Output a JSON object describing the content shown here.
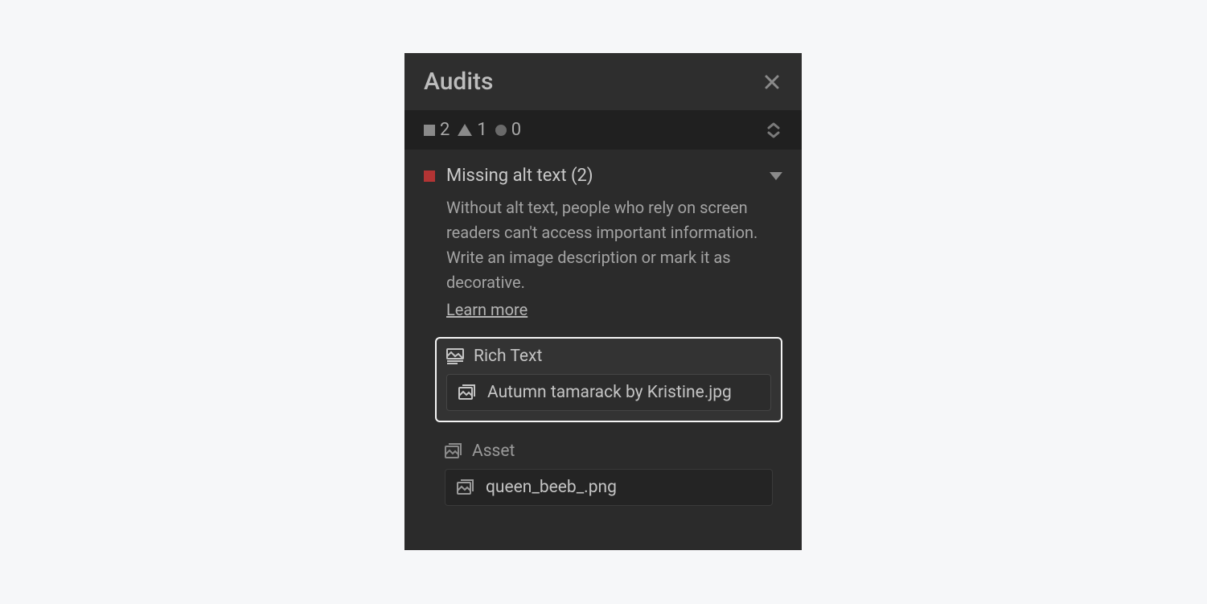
{
  "panel": {
    "title": "Audits"
  },
  "summary": {
    "errors": "2",
    "warnings": "1",
    "info": "0"
  },
  "audit": {
    "title": "Missing alt text (2)",
    "description": "Without alt text, people who rely on screen readers can't access important information. Write an image description or mark it as decorative.",
    "learn_more": "Learn more"
  },
  "groups": [
    {
      "label": "Rich Text",
      "highlighted": true,
      "item": "Autumn tamarack by Kristine.jpg"
    },
    {
      "label": "Asset",
      "highlighted": false,
      "item": "queen_beeb_.png"
    }
  ]
}
